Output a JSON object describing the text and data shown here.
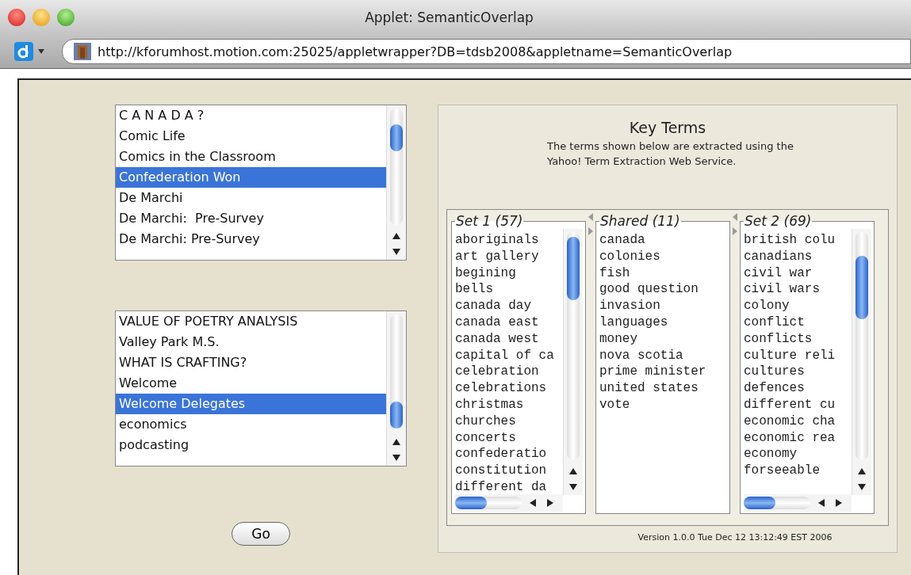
{
  "window": {
    "title": "Applet: SemanticOverlap"
  },
  "toolbar": {
    "url": "http://kforumhost.motion.com:25025/appletwrapper?DB=tdsb2008&appletname=SemanticOverlap"
  },
  "lists": [
    {
      "items": [
        {
          "label": "C A N A D A ?",
          "selected": false
        },
        {
          "label": "Comic Life",
          "selected": false
        },
        {
          "label": "Comics in the Classroom",
          "selected": false
        },
        {
          "label": "Confederation Won",
          "selected": true
        },
        {
          "label": "De Marchi",
          "selected": false
        },
        {
          "label": "De Marchi:  Pre-Survey",
          "selected": false
        },
        {
          "label": "De Marchi: Pre-Survey",
          "selected": false
        }
      ]
    },
    {
      "items": [
        {
          "label": "VALUE OF POETRY ANALYSIS",
          "selected": false
        },
        {
          "label": "Valley Park M.S.",
          "selected": false
        },
        {
          "label": "WHAT IS CRAFTING?",
          "selected": false
        },
        {
          "label": "Welcome",
          "selected": false
        },
        {
          "label": "Welcome Delegates",
          "selected": true
        },
        {
          "label": "economics",
          "selected": false
        },
        {
          "label": "podcasting",
          "selected": false
        }
      ]
    }
  ],
  "go_button": "Go",
  "key_terms": {
    "title": "Key Terms",
    "description": "The terms shown below are extracted using the Yahoo! Term Extraction Web Service.",
    "columns": [
      {
        "kind": "scrolling",
        "title": "Set 1 (57)",
        "terms": [
          "aboriginals",
          "art gallery",
          "begining",
          "bells",
          "canada day",
          "canada east",
          "canada west",
          "capital of ca",
          "celebration",
          "celebrations",
          "christmas",
          "churches",
          "concerts",
          "confederatio",
          "constitution",
          "different da"
        ]
      },
      {
        "kind": "plain",
        "title": "Shared (11)",
        "terms": [
          "canada",
          "colonies",
          "fish",
          "good question",
          "invasion",
          "languages",
          "money",
          "nova scotia",
          "prime minister",
          "united states",
          "vote"
        ]
      },
      {
        "kind": "scrolling",
        "title": "Set 2 (69)",
        "terms": [
          "british colu",
          "canadians",
          "civil war",
          "civil wars",
          "colony",
          "conflict",
          "conflicts",
          "culture reli",
          "cultures",
          "defences",
          "different cu",
          "economic cha",
          "economic rea",
          "economy",
          "forseeable"
        ]
      }
    ],
    "version": "Version 1.0.0 Tue Dec 12 13:12:49 EST 2006"
  }
}
